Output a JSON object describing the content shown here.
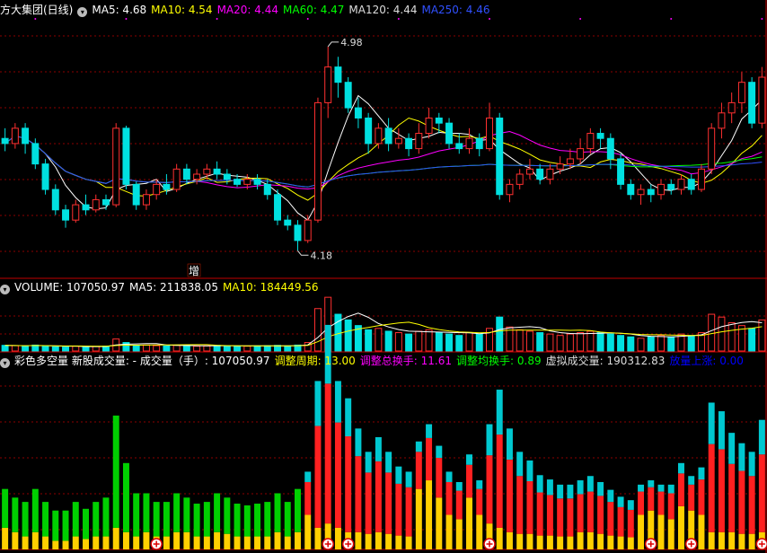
{
  "panel1": {
    "title": "方大集团(日线)",
    "ma": [
      {
        "label": "MA5: 4.68",
        "color": "#ffffff"
      },
      {
        "label": "MA10: 4.54",
        "color": "#ffff00"
      },
      {
        "label": "MA20: 4.44",
        "color": "#ff00ff"
      },
      {
        "label": "MA60: 4.47",
        "color": "#00ff00"
      },
      {
        "label": "MA120: 4.44",
        "color": "#dddddd"
      },
      {
        "label": "MA250: 4.46",
        "color": "#3050ff"
      }
    ],
    "high_label": "4.98",
    "low_label": "4.18",
    "marker": "增"
  },
  "panel2": {
    "title": "VOLUME: 107050.97",
    "ma": [
      {
        "label": "MA5: 211838.05",
        "color": "#ffffff"
      },
      {
        "label": "MA10: 184449.56",
        "color": "#ffff00"
      }
    ]
  },
  "panel3": {
    "title": "彩色多空量 新股成交量: - 成交量（手）: 107050.97",
    "items": [
      {
        "label": "调整周期: 13.00",
        "color": "#ffff00"
      },
      {
        "label": "调整总换手: 11.61",
        "color": "#ff00ff"
      },
      {
        "label": "调整均换手: 0.89",
        "color": "#00ff00"
      },
      {
        "label": "虚拟成交量: 190312.83",
        "color": "#dddddd"
      },
      {
        "label": "放量上涨: 0.00",
        "color": "#0000ff"
      }
    ]
  },
  "colors": {
    "up": "#ff3030",
    "down": "#00e0e0",
    "grid": "#8b0000",
    "border": "#c00000"
  },
  "chart_data": {
    "type": "candlestick",
    "ylim": [
      4.1,
      5.05
    ],
    "high_value": 4.98,
    "low_value": 4.18,
    "candles": [
      [
        4.62,
        4.6,
        4.66,
        4.57
      ],
      [
        4.6,
        4.66,
        4.68,
        4.58
      ],
      [
        4.66,
        4.6,
        4.68,
        4.56
      ],
      [
        4.6,
        4.52,
        4.62,
        4.5
      ],
      [
        4.52,
        4.42,
        4.54,
        4.4
      ],
      [
        4.42,
        4.34,
        4.44,
        4.32
      ],
      [
        4.34,
        4.3,
        4.36,
        4.27
      ],
      [
        4.3,
        4.36,
        4.38,
        4.29
      ],
      [
        4.36,
        4.34,
        4.4,
        4.32
      ],
      [
        4.34,
        4.38,
        4.4,
        4.33
      ],
      [
        4.38,
        4.36,
        4.4,
        4.34
      ],
      [
        4.36,
        4.66,
        4.68,
        4.35
      ],
      [
        4.66,
        4.44,
        4.67,
        4.42
      ],
      [
        4.44,
        4.36,
        4.45,
        4.34
      ],
      [
        4.36,
        4.4,
        4.42,
        4.34
      ],
      [
        4.4,
        4.44,
        4.46,
        4.38
      ],
      [
        4.44,
        4.42,
        4.48,
        4.4
      ],
      [
        4.42,
        4.5,
        4.52,
        4.41
      ],
      [
        4.5,
        4.46,
        4.52,
        4.44
      ],
      [
        4.46,
        4.48,
        4.5,
        4.44
      ],
      [
        4.48,
        4.5,
        4.52,
        4.46
      ],
      [
        4.5,
        4.48,
        4.53,
        4.46
      ],
      [
        4.48,
        4.46,
        4.5,
        4.44
      ],
      [
        4.46,
        4.44,
        4.48,
        4.43
      ],
      [
        4.44,
        4.46,
        4.48,
        4.42
      ],
      [
        4.46,
        4.44,
        4.48,
        4.42
      ],
      [
        4.44,
        4.4,
        4.46,
        4.38
      ],
      [
        4.4,
        4.3,
        4.42,
        4.28
      ],
      [
        4.3,
        4.28,
        4.32,
        4.26
      ],
      [
        4.28,
        4.22,
        4.3,
        4.18
      ],
      [
        4.22,
        4.3,
        4.32,
        4.21
      ],
      [
        4.3,
        4.76,
        4.78,
        4.29
      ],
      [
        4.76,
        4.9,
        4.98,
        4.7
      ],
      [
        4.9,
        4.84,
        4.94,
        4.78
      ],
      [
        4.84,
        4.74,
        4.86,
        4.72
      ],
      [
        4.74,
        4.7,
        4.78,
        4.66
      ],
      [
        4.7,
        4.6,
        4.72,
        4.56
      ],
      [
        4.6,
        4.66,
        4.68,
        4.58
      ],
      [
        4.66,
        4.6,
        4.7,
        4.57
      ],
      [
        4.6,
        4.62,
        4.66,
        4.58
      ],
      [
        4.62,
        4.58,
        4.64,
        4.55
      ],
      [
        4.58,
        4.64,
        4.68,
        4.56
      ],
      [
        4.64,
        4.7,
        4.74,
        4.62
      ],
      [
        4.7,
        4.68,
        4.72,
        4.64
      ],
      [
        4.68,
        4.6,
        4.7,
        4.58
      ],
      [
        4.6,
        4.58,
        4.64,
        4.56
      ],
      [
        4.58,
        4.62,
        4.66,
        4.56
      ],
      [
        4.62,
        4.58,
        4.64,
        4.55
      ],
      [
        4.58,
        4.7,
        4.76,
        4.57
      ],
      [
        4.7,
        4.4,
        4.72,
        4.38
      ],
      [
        4.4,
        4.44,
        4.46,
        4.37
      ],
      [
        4.44,
        4.48,
        4.5,
        4.42
      ],
      [
        4.48,
        4.5,
        4.54,
        4.46
      ],
      [
        4.5,
        4.46,
        4.52,
        4.44
      ],
      [
        4.46,
        4.5,
        4.52,
        4.44
      ],
      [
        4.5,
        4.52,
        4.55,
        4.48
      ],
      [
        4.52,
        4.54,
        4.58,
        4.5
      ],
      [
        4.54,
        4.58,
        4.62,
        4.52
      ],
      [
        4.58,
        4.64,
        4.66,
        4.56
      ],
      [
        4.64,
        4.62,
        4.66,
        4.58
      ],
      [
        4.62,
        4.54,
        4.64,
        4.5
      ],
      [
        4.54,
        4.44,
        4.56,
        4.42
      ],
      [
        4.44,
        4.4,
        4.46,
        4.38
      ],
      [
        4.4,
        4.42,
        4.44,
        4.36
      ],
      [
        4.42,
        4.4,
        4.44,
        4.37
      ],
      [
        4.4,
        4.44,
        4.46,
        4.38
      ],
      [
        4.44,
        4.42,
        4.46,
        4.4
      ],
      [
        4.42,
        4.46,
        4.48,
        4.4
      ],
      [
        4.46,
        4.42,
        4.48,
        4.4
      ],
      [
        4.42,
        4.5,
        4.52,
        4.41
      ],
      [
        4.5,
        4.66,
        4.68,
        4.48
      ],
      [
        4.66,
        4.72,
        4.76,
        4.62
      ],
      [
        4.72,
        4.76,
        4.8,
        4.68
      ],
      [
        4.76,
        4.84,
        4.88,
        4.72
      ],
      [
        4.84,
        4.68,
        4.86,
        4.66
      ],
      [
        4.68,
        4.86,
        4.9,
        4.66
      ]
    ],
    "volume": [
      40,
      38,
      35,
      42,
      36,
      30,
      28,
      34,
      30,
      32,
      35,
      85,
      60,
      40,
      42,
      38,
      36,
      40,
      38,
      34,
      36,
      40,
      38,
      35,
      34,
      36,
      38,
      40,
      36,
      42,
      60,
      300,
      380,
      260,
      220,
      180,
      150,
      160,
      140,
      130,
      120,
      140,
      150,
      130,
      120,
      110,
      130,
      120,
      160,
      240,
      170,
      150,
      140,
      130,
      120,
      110,
      120,
      130,
      140,
      130,
      120,
      110,
      100,
      90,
      100,
      110,
      100,
      120,
      110,
      130,
      260,
      240,
      200,
      180,
      160,
      220
    ],
    "vol_ylim": [
      0,
      400
    ],
    "colored": [
      [
        45,
        25,
        0
      ],
      [
        40,
        20,
        0
      ],
      [
        40,
        15,
        0
      ],
      [
        50,
        20,
        0
      ],
      [
        40,
        15,
        0
      ],
      [
        35,
        10,
        0
      ],
      [
        35,
        10,
        0
      ],
      [
        40,
        15,
        0
      ],
      [
        35,
        12,
        0
      ],
      [
        40,
        15,
        0
      ],
      [
        45,
        15,
        0
      ],
      [
        130,
        25,
        0
      ],
      [
        80,
        20,
        0
      ],
      [
        50,
        15,
        0
      ],
      [
        45,
        20,
        0
      ],
      [
        40,
        15,
        0
      ],
      [
        40,
        15,
        0
      ],
      [
        45,
        20,
        0
      ],
      [
        40,
        20,
        0
      ],
      [
        38,
        15,
        0
      ],
      [
        40,
        15,
        0
      ],
      [
        45,
        20,
        0
      ],
      [
        42,
        18,
        0
      ],
      [
        38,
        15,
        0
      ],
      [
        36,
        15,
        0
      ],
      [
        38,
        15,
        0
      ],
      [
        40,
        15,
        0
      ],
      [
        45,
        20,
        0
      ],
      [
        40,
        15,
        0
      ],
      [
        50,
        20,
        0
      ],
      [
        40,
        20,
        30
      ],
      [
        25,
        40,
        130
      ],
      [
        30,
        60,
        170
      ],
      [
        25,
        50,
        120
      ],
      [
        20,
        45,
        110
      ],
      [
        20,
        40,
        80
      ],
      [
        18,
        35,
        60
      ],
      [
        20,
        40,
        70
      ],
      [
        18,
        35,
        60
      ],
      [
        16,
        30,
        50
      ],
      [
        15,
        30,
        45
      ],
      [
        70,
        25,
        30
      ],
      [
        80,
        25,
        40
      ],
      [
        60,
        25,
        35
      ],
      [
        40,
        20,
        30
      ],
      [
        35,
        18,
        25
      ],
      [
        60,
        20,
        30
      ],
      [
        40,
        15,
        25
      ],
      [
        30,
        25,
        90
      ],
      [
        25,
        30,
        130
      ],
      [
        20,
        30,
        90
      ],
      [
        18,
        25,
        70
      ],
      [
        18,
        25,
        60
      ],
      [
        16,
        20,
        50
      ],
      [
        16,
        20,
        45
      ],
      [
        15,
        20,
        40
      ],
      [
        15,
        20,
        40
      ],
      [
        20,
        20,
        40
      ],
      [
        20,
        20,
        45
      ],
      [
        18,
        20,
        40
      ],
      [
        16,
        18,
        35
      ],
      [
        15,
        16,
        30
      ],
      [
        14,
        15,
        28
      ],
      [
        40,
        15,
        20
      ],
      [
        45,
        15,
        20
      ],
      [
        40,
        15,
        20
      ],
      [
        35,
        15,
        25
      ],
      [
        50,
        20,
        30
      ],
      [
        45,
        15,
        25
      ],
      [
        40,
        20,
        35
      ],
      [
        20,
        30,
        120
      ],
      [
        20,
        30,
        110
      ],
      [
        20,
        25,
        90
      ],
      [
        18,
        25,
        80
      ],
      [
        18,
        25,
        70
      ],
      [
        20,
        30,
        100
      ]
    ],
    "colored_ylim": [
      0,
      210
    ]
  }
}
